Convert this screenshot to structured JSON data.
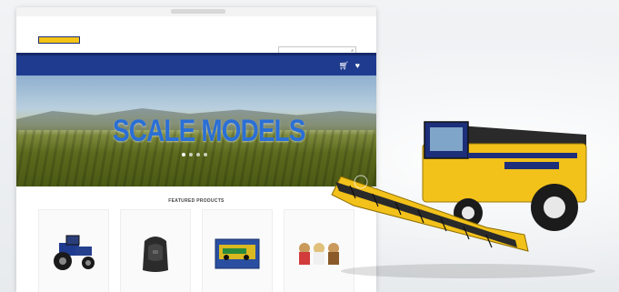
{
  "browser": {
    "url": ""
  },
  "header": {
    "logo_line1": "",
    "logo_line2": "",
    "links": [
      "",
      "",
      ""
    ],
    "search_placeholder": ""
  },
  "nav": {
    "items": [
      "",
      "",
      "",
      "",
      "",
      "",
      ""
    ],
    "cart_icon": "cart-icon",
    "wishlist_icon": "heart-icon",
    "color": "#1f3b8f"
  },
  "hero": {
    "headline": "SCALE MODELS",
    "slide_count": 4,
    "active_slide": 1
  },
  "featured": {
    "title": "FEATURED PRODUCTS",
    "products": [
      {
        "name": "",
        "thumb": "tractor"
      },
      {
        "name": "",
        "thumb": "backpack"
      },
      {
        "name": "",
        "thumb": "boxed-model"
      },
      {
        "name": "",
        "thumb": "plush-toys"
      }
    ]
  },
  "colors": {
    "brand_blue": "#1f3b8f",
    "brand_yellow": "#f3c317"
  }
}
